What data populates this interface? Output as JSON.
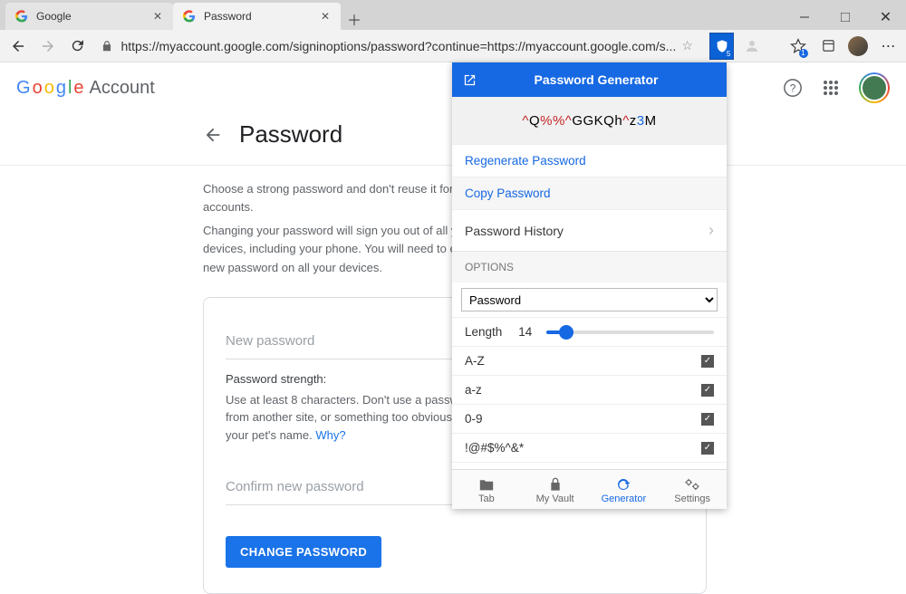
{
  "browser": {
    "tabs": [
      {
        "label": "Google",
        "active": false
      },
      {
        "label": "Password",
        "active": true
      }
    ],
    "url": "https://myaccount.google.com/signinoptions/password?continue=https://myaccount.google.com/s..."
  },
  "page": {
    "brand_word": "Google",
    "brand_suffix": "Account",
    "heading": "Password",
    "sub1": "Choose a strong password and don't reuse it for other accounts.",
    "sub2": "Changing your password will sign you out of all your devices, including your phone. You will need to enter your new password on all your devices.",
    "new_password_placeholder": "New password",
    "strength_label": "Password strength:",
    "hint_text": "Use at least 8 characters. Don't use a password from another site, or something too obvious like your pet's name. ",
    "hint_link": "Why?",
    "confirm_placeholder": "Confirm new password",
    "change_button": "CHANGE PASSWORD"
  },
  "popup": {
    "title": "Password Generator",
    "password_parts": [
      {
        "t": "^",
        "c": "r"
      },
      {
        "t": "Q",
        "c": ""
      },
      {
        "t": "%%^",
        "c": "r"
      },
      {
        "t": "GGKQh",
        "c": ""
      },
      {
        "t": "^",
        "c": "r"
      },
      {
        "t": "z",
        "c": ""
      },
      {
        "t": "3",
        "c": "b"
      },
      {
        "t": "M",
        "c": ""
      }
    ],
    "regenerate": "Regenerate Password",
    "copy": "Copy Password",
    "history": "Password History",
    "options_label": "OPTIONS",
    "type_select": "Password",
    "length_label": "Length",
    "length_value": "14",
    "rows": [
      {
        "label": "A-Z",
        "checked": true
      },
      {
        "label": "a-z",
        "checked": true
      },
      {
        "label": "0-9",
        "checked": true
      },
      {
        "label": "!@#$%^&*",
        "checked": true
      }
    ],
    "nav": [
      {
        "label": "Tab",
        "icon": "folder"
      },
      {
        "label": "My Vault",
        "icon": "lock"
      },
      {
        "label": "Generator",
        "icon": "refresh",
        "active": true
      },
      {
        "label": "Settings",
        "icon": "gears"
      }
    ]
  }
}
